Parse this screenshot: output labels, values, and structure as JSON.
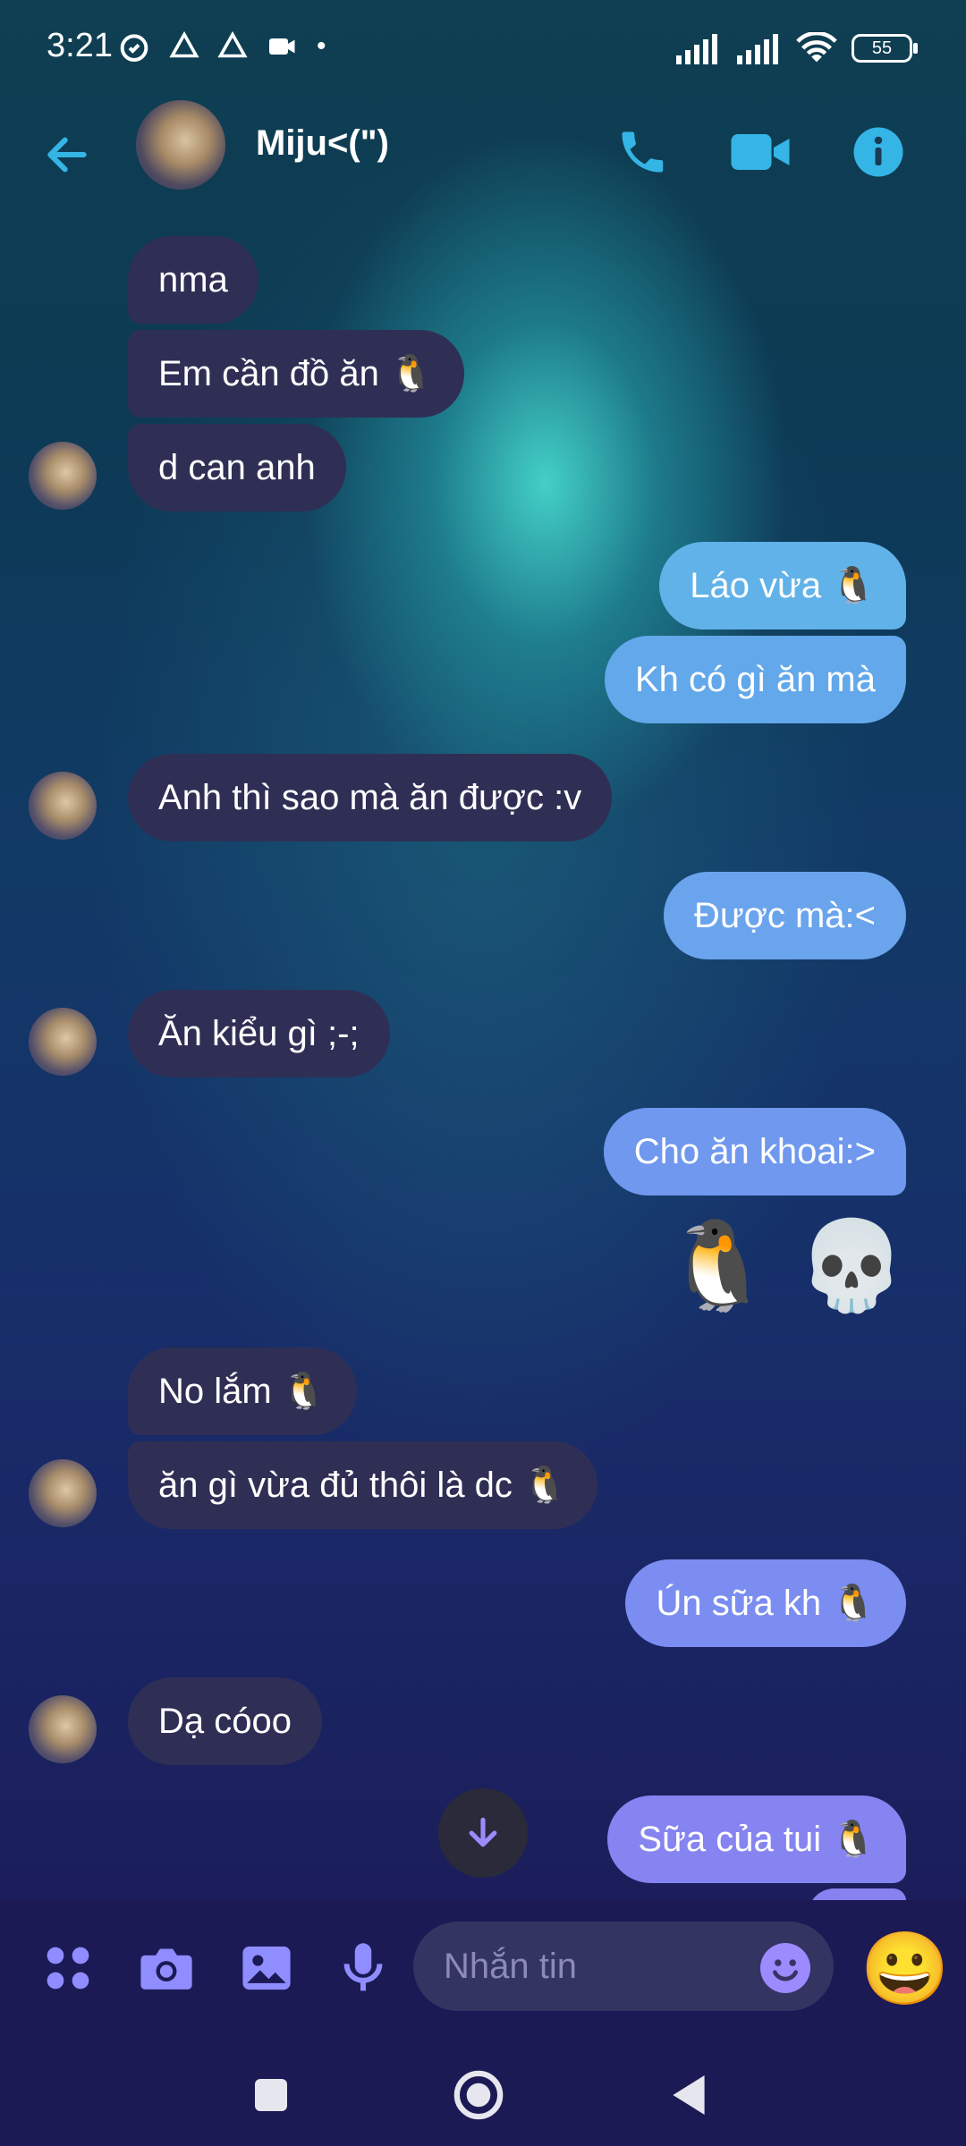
{
  "status_bar": {
    "time": "3:21",
    "battery": "55"
  },
  "header": {
    "contact_name": "Miju<(\")",
    "accent": "#35b4e6"
  },
  "composer": {
    "placeholder": "Nhắn tin",
    "big_emoji": "😀"
  },
  "messages": [
    {
      "side": "in",
      "text": "nma"
    },
    {
      "side": "in",
      "text": "Em cần đồ ăn 🐧"
    },
    {
      "side": "in",
      "text": "d can anh"
    },
    {
      "side": "out",
      "text": "Láo vừa 🐧"
    },
    {
      "side": "out",
      "text": "Kh có gì ăn mà"
    },
    {
      "side": "in",
      "text": "Anh thì sao mà ăn được :v"
    },
    {
      "side": "out",
      "text": "Được mà:<"
    },
    {
      "side": "in",
      "text": "Ăn kiểu gì ;-;"
    },
    {
      "side": "out",
      "text": "Cho ăn khoai:>"
    },
    {
      "side": "out",
      "text": "🐧 💀"
    },
    {
      "side": "in",
      "text": "No lắm 🐧"
    },
    {
      "side": "in",
      "text": "ăn gì vừa đủ thôi là dc 🐧"
    },
    {
      "side": "out",
      "text": "Ún sữa kh 🐧"
    },
    {
      "side": "in",
      "text": "Dạ cóoo"
    },
    {
      "side": "out",
      "text": "Sữa của tui 🐧"
    }
  ]
}
